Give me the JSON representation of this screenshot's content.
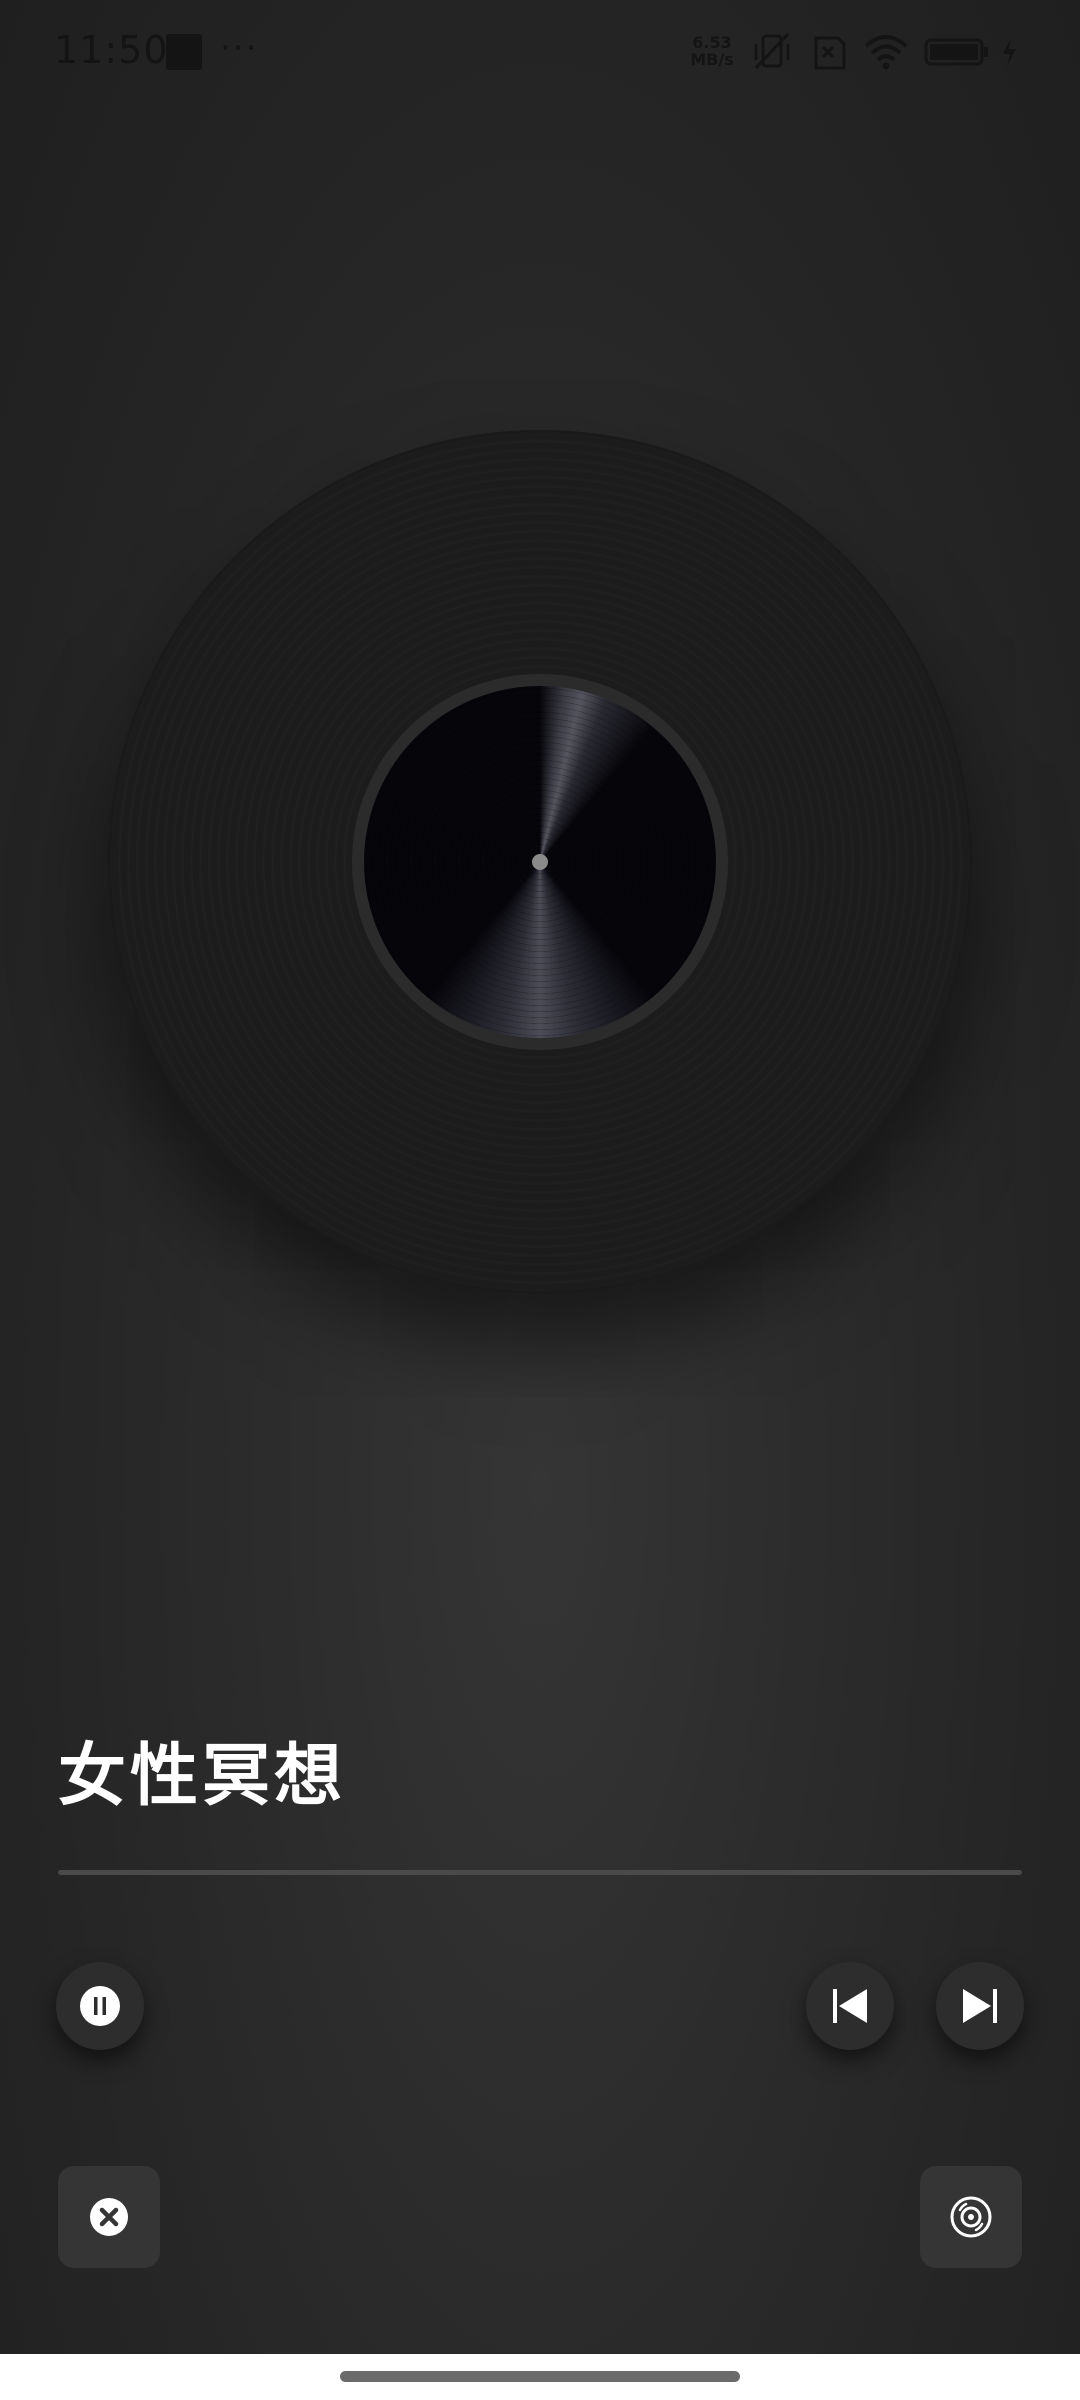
{
  "status_bar": {
    "time": "11:50",
    "more": "···",
    "speed_value": "6.53",
    "speed_unit": "MB/s",
    "icons": [
      "app-square-icon",
      "vibrate-off-icon",
      "sim-blocked-icon",
      "wifi-icon",
      "battery-icon",
      "charging-icon"
    ]
  },
  "player": {
    "title": "女性冥想",
    "progress": 0.0,
    "state": "playing"
  },
  "controls": {
    "icons": {
      "pause": "pause-icon",
      "previous": "skip-previous-icon",
      "next": "skip-next-icon",
      "close": "close-icon",
      "disc": "disc-icon"
    }
  },
  "colors": {
    "background": "#2c2c2c",
    "title": "#ffffff",
    "progress_track": "#4a4a4a",
    "button": "#2d2d2d",
    "square_button": "#353535"
  }
}
